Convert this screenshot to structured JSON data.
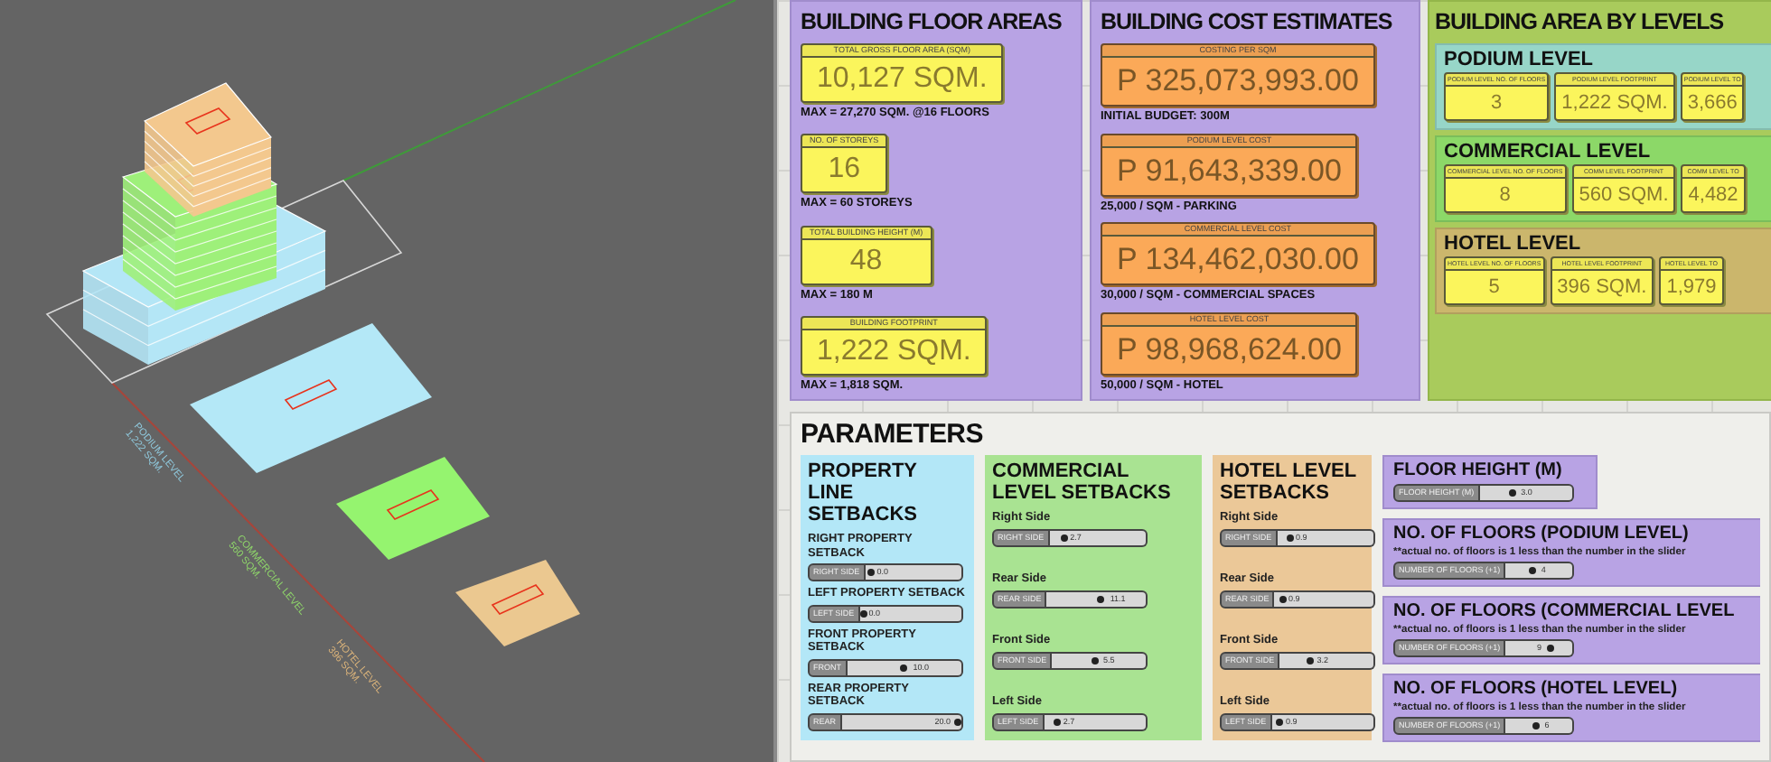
{
  "viewport": {
    "labels": [
      {
        "name": "PODIUM LEVEL",
        "area": "1,222 SQM.",
        "color": "#8fc8dc"
      },
      {
        "name": "COMMERCIAL LEVEL",
        "area": "560 SQM.",
        "color": "#8ed46a"
      },
      {
        "name": "HOTEL LEVEL",
        "area": "396 SQM.",
        "color": "#d9b27a"
      }
    ]
  },
  "floor_areas": {
    "title": "BUILDING FLOOR AREAS",
    "items": [
      {
        "label": "TOTAL GROSS FLOOR AREA (SQM)",
        "value": "10,127 SQM.",
        "note": "MAX = 27,270 SQM. @16 FLOORS"
      },
      {
        "label": "NO. OF STOREYS",
        "value": "16",
        "note": "MAX = 60 STOREYS"
      },
      {
        "label": "TOTAL BUILDING HEIGHT (M)",
        "value": "48",
        "note": "MAX = 180 M"
      },
      {
        "label": "BUILDING FOOTPRINT",
        "value": "1,222 SQM.",
        "note": "MAX = 1,818 SQM."
      }
    ]
  },
  "cost_estimates": {
    "title": "BUILDING COST ESTIMATES",
    "items": [
      {
        "label": "COSTING PER SQM",
        "value": "P 325,073,993.00",
        "note": "INITIAL BUDGET: 300M"
      },
      {
        "label": "PODIUM LEVEL COST",
        "value": "P 91,643,339.00",
        "note": "25,000 / SQM - PARKING"
      },
      {
        "label": "COMMERCIAL LEVEL COST",
        "value": "P 134,462,030.00",
        "note": "30,000 / SQM - COMMERCIAL SPACES"
      },
      {
        "label": "HOTEL LEVEL COST",
        "value": "P 98,968,624.00",
        "note": "50,000 / SQM - HOTEL"
      }
    ]
  },
  "area_by_levels": {
    "title": "BUILDING AREA BY LEVELS",
    "levels": [
      {
        "title": "PODIUM LEVEL",
        "color": "#97d6c8",
        "nodes": [
          {
            "label": "PODIUM LEVEL NO. OF FLOORS",
            "value": "3"
          },
          {
            "label": "PODIUM LEVEL FOOTPRINT",
            "value": "1,222 SQM."
          },
          {
            "label": "PODIUM LEVEL TO",
            "value": "3,666"
          }
        ]
      },
      {
        "title": "COMMERCIAL LEVEL",
        "color": "#8cd868",
        "nodes": [
          {
            "label": "COMMERCIAL LEVEL NO. OF FLOORS",
            "value": "8"
          },
          {
            "label": "COMM LEVEL FOOTPRINT",
            "value": "560 SQM."
          },
          {
            "label": "COMM LEVEL TO",
            "value": "4,482"
          }
        ]
      },
      {
        "title": "HOTEL LEVEL",
        "color": "#cbb66c",
        "nodes": [
          {
            "label": "HOTEL LEVEL NO. OF FLOORS",
            "value": "5"
          },
          {
            "label": "HOTEL LEVEL FOOTPRINT",
            "value": "396 SQM."
          },
          {
            "label": "HOTEL LEVEL TO",
            "value": "1,979"
          }
        ]
      }
    ]
  },
  "parameters": {
    "title": "PARAMETERS",
    "setback_groups": [
      {
        "title": "PROPERTY LINE SETBACKS",
        "color": "#b3e7f7",
        "sliders": [
          {
            "label": "RIGHT PROPERTY SETBACK",
            "name": "RIGHT SIDE",
            "value": "0.0",
            "level": 0.03
          },
          {
            "label": "LEFT PROPERTY SETBACK",
            "name": "LEFT SIDE",
            "value": "0.0",
            "level": 0.0
          },
          {
            "label": "FRONT PROPERTY SETBACK",
            "name": "FRONT",
            "value": "10.0",
            "level": 0.5
          },
          {
            "label": "REAR PROPERTY SETBACK",
            "name": "REAR",
            "value": "20.0",
            "level": 1.0
          }
        ]
      },
      {
        "title": "COMMERCIAL LEVEL SETBACKS",
        "color": "#a9e392",
        "sliders": [
          {
            "label": "Right Side",
            "name": "RIGHT SIDE",
            "value": "2.7",
            "level": 0.12
          },
          {
            "label": "Rear Side",
            "name": "REAR SIDE",
            "value": "11.1",
            "level": 0.55
          },
          {
            "label": "Front Side",
            "name": "FRONT SIDE",
            "value": "5.5",
            "level": 0.45
          },
          {
            "label": "Left Side",
            "name": "LEFT SIDE",
            "value": "2.7",
            "level": 0.1
          }
        ]
      },
      {
        "title": "HOTEL LEVEL SETBACKS",
        "color": "#ebc898",
        "sliders": [
          {
            "label": "Right Side",
            "name": "RIGHT SIDE",
            "value": "0.9",
            "level": 0.1
          },
          {
            "label": "Rear Side",
            "name": "REAR SIDE",
            "value": "0.9",
            "level": 0.05
          },
          {
            "label": "Front Side",
            "name": "FRONT SIDE",
            "value": "3.2",
            "level": 0.3
          },
          {
            "label": "Left Side",
            "name": "LEFT SIDE",
            "value": "0.9",
            "level": 0.05
          }
        ]
      }
    ],
    "floor_sliders": [
      {
        "title": "FLOOR HEIGHT (M)",
        "name": "FLOOR HEIGHT (M)",
        "value": "3.0",
        "level": 0.35
      },
      {
        "title": "NO. OF FLOORS (PODIUM LEVEL)",
        "note": "**actual no. of floors is 1 less than the number in the slider",
        "name": "NUMBER OF FLOORS (+1)",
        "value": "4",
        "level": 0.4
      },
      {
        "title": "NO. OF FLOORS (COMMERCIAL LEVEL",
        "note": "**actual no. of floors is 1 less than the number in the slider",
        "name": "NUMBER OF FLOORS (+1)",
        "value": "9",
        "level": 0.7
      },
      {
        "title": "NO. OF FLOORS (HOTEL LEVEL)",
        "note": "**actual no. of floors is 1 less than the number in the slider",
        "name": "NUMBER OF FLOORS (+1)",
        "value": "6",
        "level": 0.45
      }
    ]
  }
}
